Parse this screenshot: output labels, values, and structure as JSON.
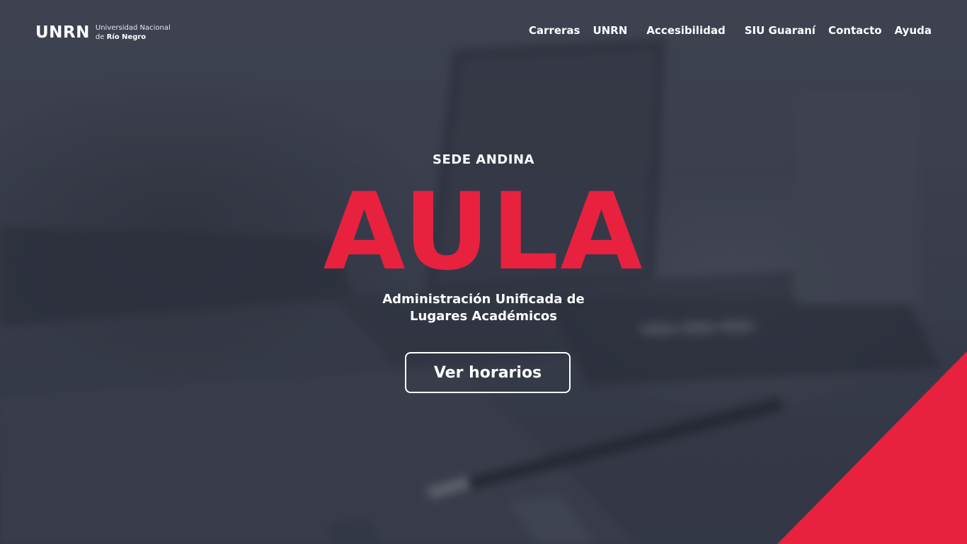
{
  "header": {
    "logo": {
      "mark": "UNRN",
      "line1": "Universidad Nacional",
      "line2_prefix": "de ",
      "line2_bold": "Río Negro"
    },
    "nav": [
      {
        "label": "Carreras"
      },
      {
        "label": "UNRN"
      },
      {
        "label": "Accesibilidad"
      },
      {
        "label": "SIU Guaraní"
      },
      {
        "label": "Contacto"
      },
      {
        "label": "Ayuda"
      }
    ]
  },
  "hero": {
    "eyebrow": "SEDE ANDINA",
    "title": "AULA",
    "subtitle_line1": "Administración Unificada de",
    "subtitle_line2": "Lugares Académicos",
    "cta_label": "Ver horarios"
  },
  "colors": {
    "accent": "#e8213f",
    "background": "#434857",
    "text": "#ffffff"
  }
}
